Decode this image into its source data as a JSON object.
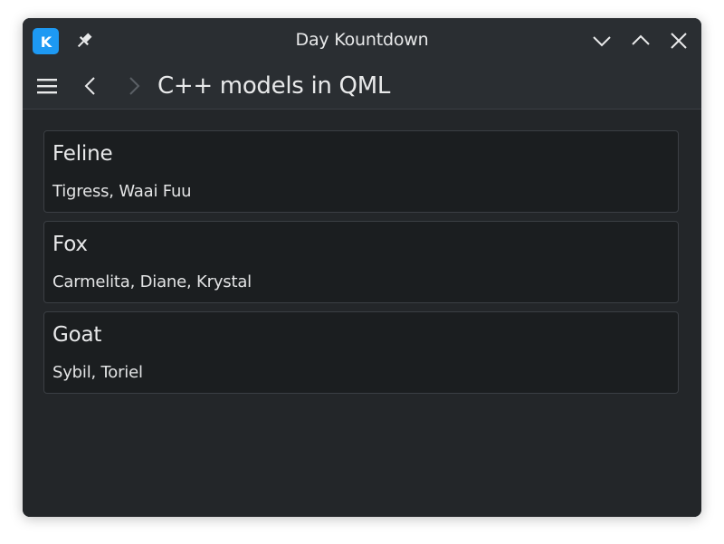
{
  "window": {
    "title": "Day Kountdown",
    "app_icon_letter": "K",
    "accent": "#1d99f3"
  },
  "toolbar": {
    "page_title": "C++ models in QML",
    "icons": [
      "hamburger-menu-icon",
      "chevron-left-icon",
      "chevron-right-icon"
    ]
  },
  "titlebar_icons": [
    "kde-app-icon",
    "pin-icon",
    "minimize-icon",
    "maximize-icon",
    "close-icon"
  ],
  "cards": [
    {
      "title": "Feline",
      "subtitle": "Tigress, Waai Fuu"
    },
    {
      "title": "Fox",
      "subtitle": "Carmelita, Diane, Krystal"
    },
    {
      "title": "Goat",
      "subtitle": "Sybil, Toriel"
    }
  ]
}
